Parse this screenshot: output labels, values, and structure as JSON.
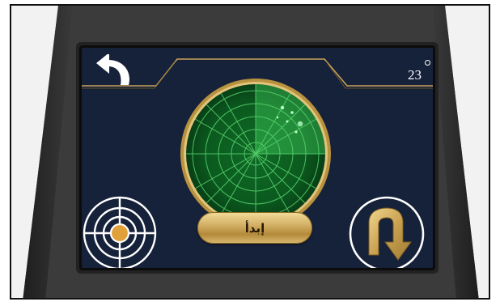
{
  "header": {
    "back_icon": "undo-arrow-icon",
    "temperature_value": "23"
  },
  "radar": {
    "icon": "radar-sweep-icon",
    "color": "#1f9e3a"
  },
  "controls": {
    "target_icon": "target-crosshair-icon",
    "start_label": "إبدأ",
    "uturn_icon": "u-turn-arrow-icon"
  },
  "colors": {
    "screen_bg": "#16213a",
    "gold": "#c9a35a",
    "radar_green": "#1f9e3a"
  }
}
